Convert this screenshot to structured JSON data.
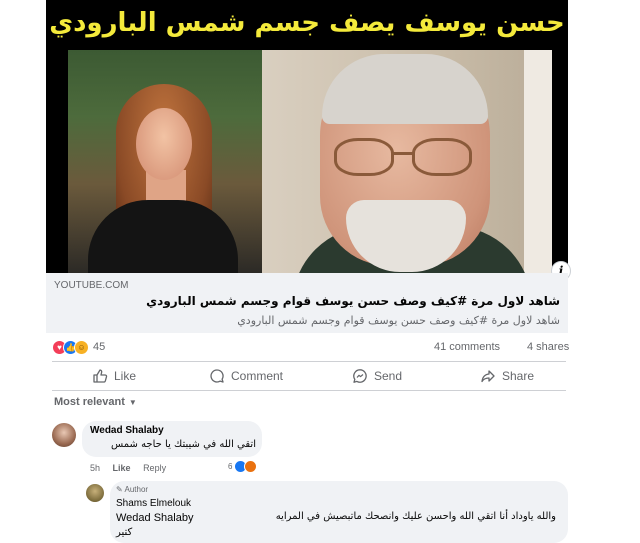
{
  "video": {
    "title_overlay": "حسن يوسف يصف جسم شمس البارودي",
    "info_icon": "info-icon"
  },
  "link_preview": {
    "domain": "YOUTUBE.COM",
    "title": "شاهد لاول مرة #كيف وصف حسن يوسف قوام وجسم شمس البارودي",
    "description": "شاهد لاول مرة #كيف وصف حسن يوسف قوام وجسم شمس البارودي"
  },
  "stats": {
    "reaction_icons": [
      "love-icon",
      "like-icon",
      "haha-icon"
    ],
    "reaction_count": "45",
    "comments": "41 comments",
    "shares": "4 shares"
  },
  "actions": {
    "like": "Like",
    "comment": "Comment",
    "send": "Send",
    "share": "Share"
  },
  "sort": {
    "label": "Most relevant"
  },
  "comments": [
    {
      "author": "Wedad Shalaby",
      "text": "اتقي الله في شيبتك يا حاجه شمس",
      "time": "5h",
      "like_label": "Like",
      "reply_label": "Reply",
      "reaction_count": "6"
    },
    {
      "badge": "Author",
      "author": "Shams Elmelouk",
      "mention": "Wedad Shalaby",
      "text_line1": "والله ياوداد أنا اتقي الله واحسن عليك وانصحك ماتبصيش في المرايه",
      "text_line2": "كتير"
    }
  ],
  "colors": {
    "overlay_title": "#f4ea3b",
    "link_box_bg": "#f0f2f5",
    "secondary_text": "#65676b",
    "like_blue": "#1877f2",
    "love_red": "#f33e58"
  }
}
